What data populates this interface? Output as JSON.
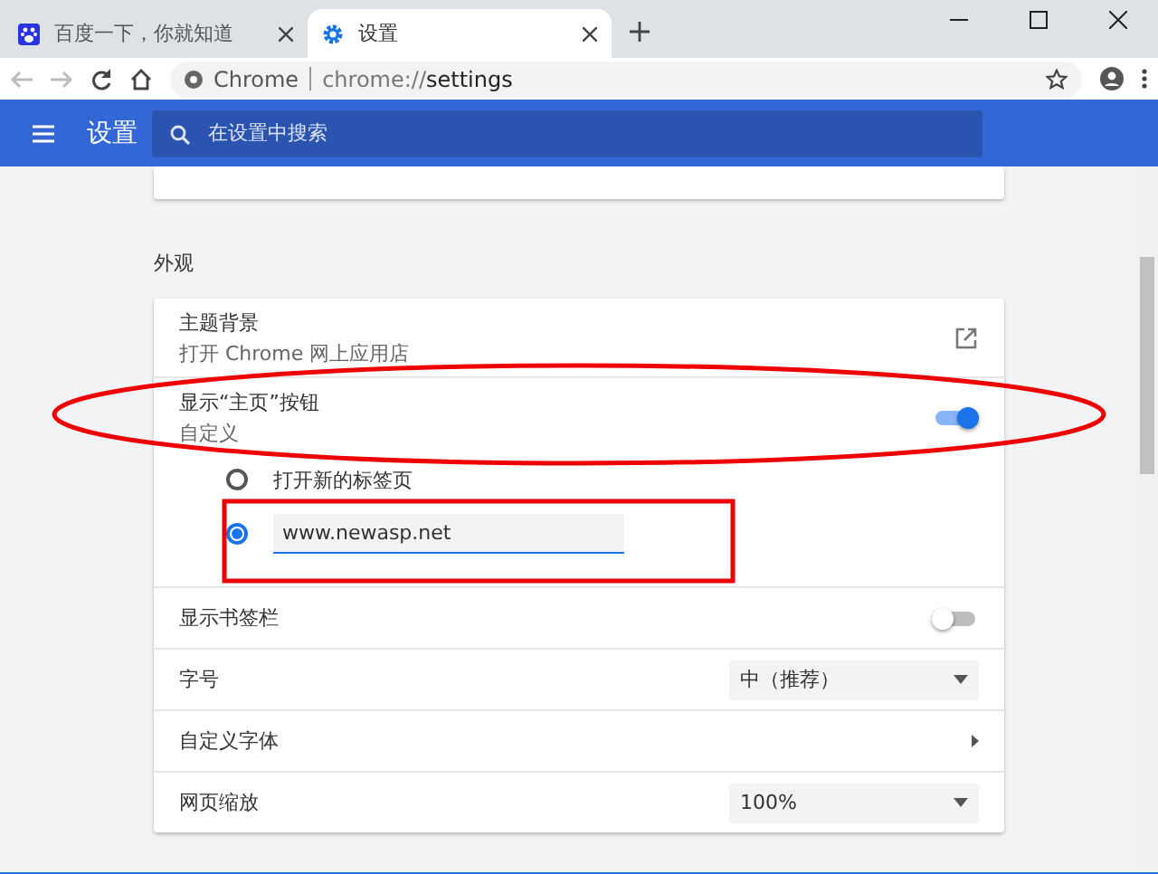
{
  "tabs": [
    {
      "title": "百度一下，你就知道",
      "selected": false
    },
    {
      "title": "设置",
      "selected": true
    }
  ],
  "address_bar": {
    "site": "Chrome",
    "url_scheme": "chrome://",
    "url_path": "settings"
  },
  "header": {
    "title": "设置",
    "search": {
      "placeholder": "在设置中搜索"
    }
  },
  "section": {
    "title": "外观",
    "rows": [
      {
        "kind": "link",
        "title": "主题背景",
        "subtitle": "打开 Chrome 网上应用店"
      },
      {
        "kind": "toggle",
        "title": "显示“主页”按钮",
        "subtitle": "自定义",
        "on": true
      },
      {
        "kind": "radio-group",
        "options": [
          {
            "kind": "label",
            "text": "打开新的标签页",
            "selected": false
          },
          {
            "kind": "input",
            "value": "www.newasp.net",
            "selected": true
          }
        ]
      },
      {
        "kind": "toggle",
        "title": "显示书签栏",
        "on": false
      },
      {
        "kind": "select",
        "title": "字号",
        "value": "中（推荐）"
      },
      {
        "kind": "submenu",
        "title": "自定义字体"
      },
      {
        "kind": "select",
        "title": "网页缩放",
        "value": "100%"
      }
    ]
  }
}
